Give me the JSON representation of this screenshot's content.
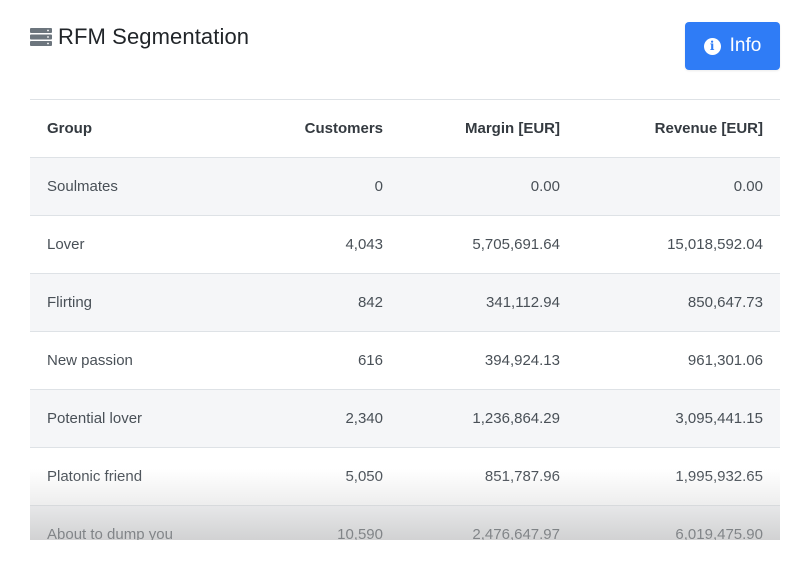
{
  "header": {
    "title": "RFM Segmentation",
    "icon": "server-stack-icon"
  },
  "info_button": {
    "label": "Info",
    "icon": "info-circle-icon",
    "color": "#2f7cf6"
  },
  "table": {
    "columns": [
      "Group",
      "Customers",
      "Margin [EUR]",
      "Revenue [EUR]"
    ],
    "rows": [
      [
        "Soulmates",
        "0",
        "0.00",
        "0.00"
      ],
      [
        "Lover",
        "4,043",
        "5,705,691.64",
        "15,018,592.04"
      ],
      [
        "Flirting",
        "842",
        "341,112.94",
        "850,647.73"
      ],
      [
        "New passion",
        "616",
        "394,924.13",
        "961,301.06"
      ],
      [
        "Potential lover",
        "2,340",
        "1,236,864.29",
        "3,095,441.15"
      ],
      [
        "Platonic friend",
        "5,050",
        "851,787.96",
        "1,995,932.65"
      ],
      [
        "About to dump you",
        "10,590",
        "2,476,647.97",
        "6,019,475.90"
      ]
    ]
  }
}
